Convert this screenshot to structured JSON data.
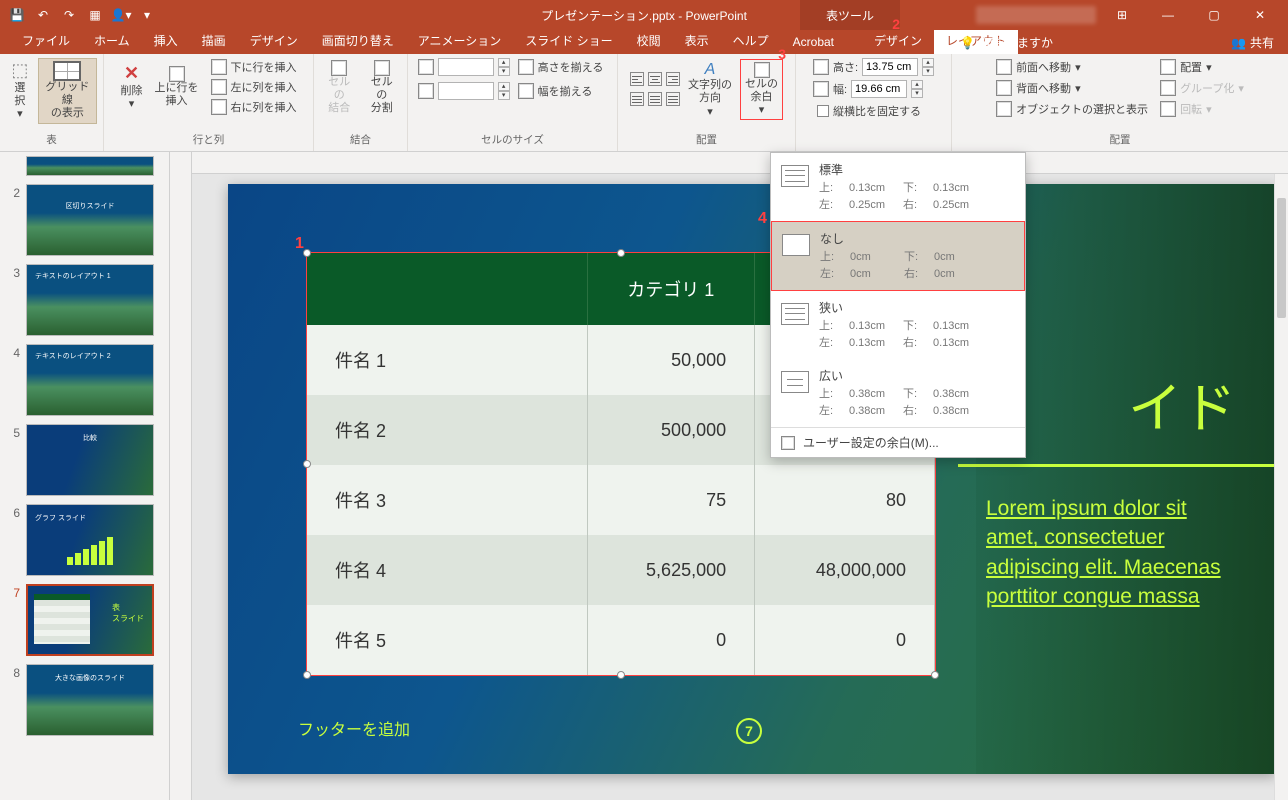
{
  "titlebar": {
    "title": "プレゼンテーション.pptx - PowerPoint",
    "tool_tab": "表ツール",
    "tool_tab_num": "2",
    "qat": [
      "💾",
      "↶",
      "↷",
      "▦",
      "👤▾",
      "▾"
    ],
    "win": {
      "board": "⊞",
      "min": "—",
      "max": "▢",
      "close": "✕"
    }
  },
  "tabs": {
    "file": "ファイル",
    "home": "ホーム",
    "insert": "挿入",
    "draw": "描画",
    "design": "デザイン",
    "transitions": "画面切り替え",
    "animations": "アニメーション",
    "slideshow": "スライド ショー",
    "review": "校閲",
    "view": "表示",
    "help": "ヘルプ",
    "acrobat": "Acrobat",
    "tbl_design": "デザイン",
    "tbl_layout": "レイアウト",
    "tell_me_icon": "💡",
    "tell_me": "何をしますか",
    "share_icon": "👥",
    "share": "共有"
  },
  "ribbon": {
    "select": {
      "label": "選択"
    },
    "gridlines": {
      "label1": "グリッド線",
      "label2": "の表示"
    },
    "tbl_group": "表",
    "delete": {
      "label": "削除"
    },
    "insert_rows": {
      "above": "上に行を\n挿入",
      "below": "下に行を挿入",
      "left": "左に列を挿入",
      "right": "右に列を挿入"
    },
    "rows_cols_group": "行と列",
    "merge": {
      "merge": "セルの\n結合",
      "split": "セルの\n分割",
      "group": "結合"
    },
    "size": {
      "height_distribute": "高さを揃える",
      "width_distribute": "幅を揃える",
      "group": "セルのサイズ"
    },
    "align": {
      "text_dir": "文字列の\n方向",
      "margins": "セルの\n余白",
      "margins_num": "3",
      "group": "配置"
    },
    "table_size": {
      "height_label": "高さ:",
      "height": "13.75 cm",
      "width_label": "幅:",
      "width": "19.66 cm",
      "lock": "縦横比を固定する"
    },
    "arrange": {
      "front": "前面へ移動",
      "back": "背面へ移動",
      "selpane": "オブジェクトの選択と表示",
      "align_btn": "配置",
      "group_btn": "グループ化",
      "rotate": "回転",
      "group": "配置"
    }
  },
  "dropdown": {
    "normal": {
      "name": "標準",
      "top": "上:",
      "top_v": "0.13cm",
      "bottom": "下:",
      "bottom_v": "0.13cm",
      "left": "左:",
      "left_v": "0.25cm",
      "right": "右:",
      "right_v": "0.25cm"
    },
    "none": {
      "name": "なし",
      "num": "4",
      "top": "上:",
      "top_v": "0cm",
      "bottom": "下:",
      "bottom_v": "0cm",
      "left": "左:",
      "left_v": "0cm",
      "right": "右:",
      "right_v": "0cm"
    },
    "narrow": {
      "name": "狭い",
      "top": "上:",
      "top_v": "0.13cm",
      "bottom": "下:",
      "bottom_v": "0.13cm",
      "left": "左:",
      "left_v": "0.13cm",
      "right": "右:",
      "right_v": "0.13cm"
    },
    "wide": {
      "name": "広い",
      "top": "上:",
      "top_v": "0.38cm",
      "bottom": "下:",
      "bottom_v": "0.38cm",
      "left": "左:",
      "left_v": "0.38cm",
      "right": "右:",
      "right_v": "0.38cm"
    },
    "custom": "ユーザー設定の余白(M)..."
  },
  "slides": {
    "nums": [
      "2",
      "3",
      "4",
      "5",
      "6",
      "7",
      "8"
    ],
    "labels": [
      "区切りスライド",
      "テキストのレイアウト 1",
      "テキストのレイアウト 2",
      "比較",
      "グラフ スライド",
      "表のスライド",
      "大きな画像のスライド"
    ]
  },
  "slide": {
    "title_suffix": "イド",
    "subtitle": "Lorem ipsum dolor sit amet, consectetuer adipiscing elit. Maecenas porttitor congue massa",
    "footer": "フッターを追加",
    "page": "7",
    "table_num": "1",
    "headers": [
      "",
      "カテゴリ 1",
      ""
    ],
    "rows": [
      {
        "c0": "件名 1",
        "c1": "50,000",
        "c2": ""
      },
      {
        "c0": "件名 2",
        "c1": "500,000",
        "c2": ""
      },
      {
        "c0": "件名 3",
        "c1": "75",
        "c2": "80"
      },
      {
        "c0": "件名 4",
        "c1": "5,625,000",
        "c2": "48,000,000"
      },
      {
        "c0": "件名 5",
        "c1": "0",
        "c2": "0"
      }
    ]
  }
}
